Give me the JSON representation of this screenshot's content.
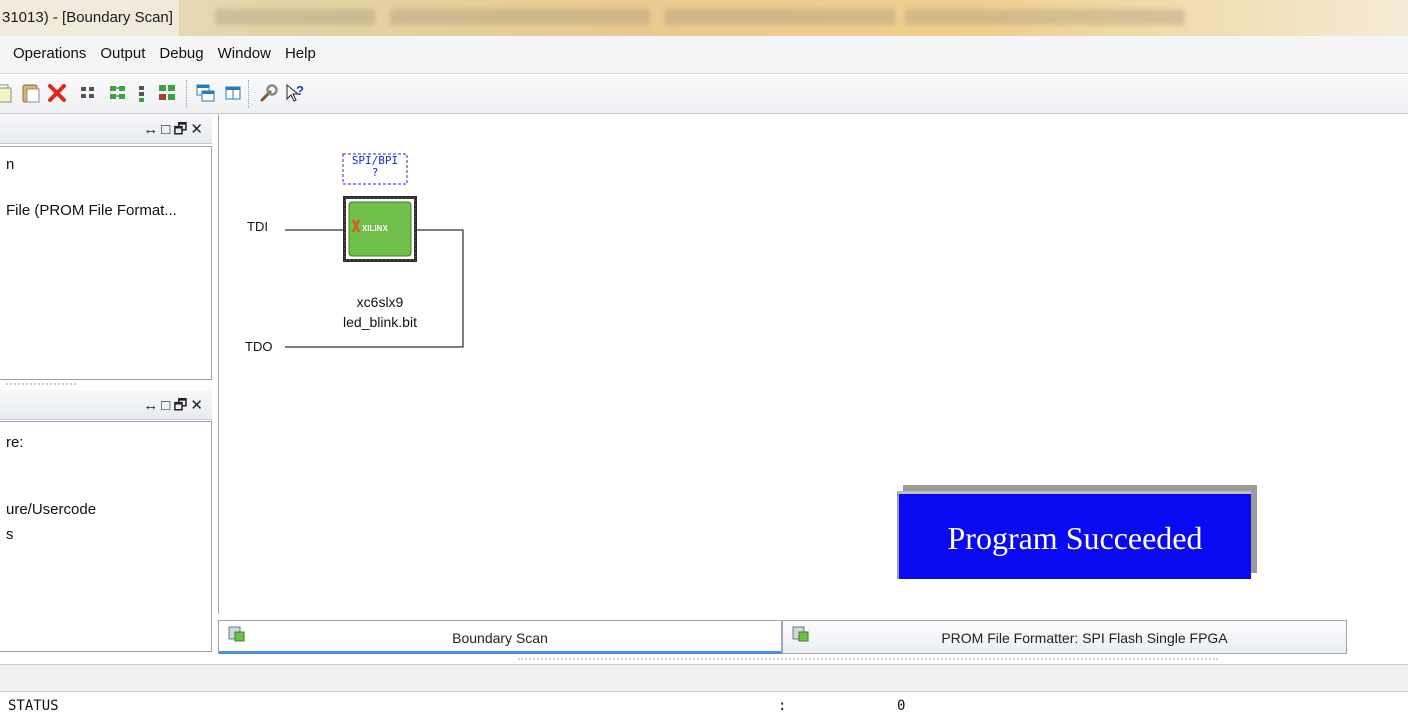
{
  "window": {
    "title": "31013) - [Boundary Scan]"
  },
  "menu": {
    "items": [
      {
        "label": "Operations"
      },
      {
        "label": "Output"
      },
      {
        "label": "Debug"
      },
      {
        "label": "Window"
      },
      {
        "label": "Help"
      }
    ]
  },
  "toolbar": {
    "icons": [
      "copy-icon",
      "paste-icon",
      "delete-icon",
      "grid-icon",
      "initialize-chain-icon",
      "chain-small-icon",
      "chain-assign-icon",
      "cascade-window-icon",
      "tile-window-icon",
      "wrench-icon",
      "context-help-icon"
    ]
  },
  "left_panel_top": {
    "controls": "↔□🗗✕",
    "lines": [
      "n",
      "File (PROM File Format..."
    ]
  },
  "left_panel_bottom": {
    "controls": "↔□🗗✕",
    "lines": [
      "re:",
      "ure/Usercode",
      "s"
    ]
  },
  "diagram": {
    "tdi_label": "TDI",
    "tdo_label": "TDO",
    "flash_label_1": "SPI/BPI",
    "flash_label_2": "?",
    "chip_logo": "XILINX",
    "device_name": "xc6slx9",
    "bitfile": "led_blink.bit"
  },
  "result_banner": {
    "text": "Program Succeeded"
  },
  "tabs": [
    {
      "label": "Boundary Scan",
      "active": true
    },
    {
      "label": "PROM File Formatter: SPI Flash Single FPGA",
      "active": false
    }
  ],
  "console": {
    "key": "STATUS",
    "separator": ":",
    "value": "0"
  },
  "colors": {
    "banner_bg": "#0a0af2",
    "chip_green": "#6fbf4a",
    "accent_blue": "#4a8fd8"
  }
}
